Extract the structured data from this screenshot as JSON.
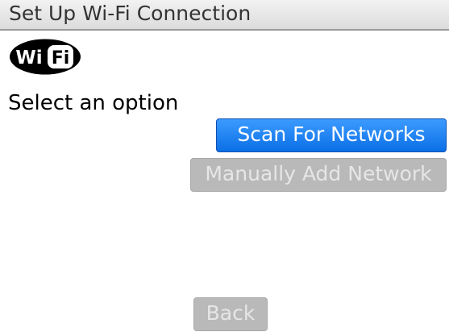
{
  "header": {
    "title": "Set Up Wi-Fi Connection"
  },
  "logo": {
    "icon": "wifi-logo-icon",
    "text_left": "Wi",
    "text_right": "Fi"
  },
  "main": {
    "prompt": "Select an option"
  },
  "options": {
    "scan_label": "Scan For Networks",
    "manual_label": "Manually Add Network"
  },
  "footer": {
    "back_label": "Back"
  },
  "colors": {
    "accent": "#1a84f5",
    "disabled": "#b9b9b9",
    "title_bar": "#e6e6e6"
  }
}
